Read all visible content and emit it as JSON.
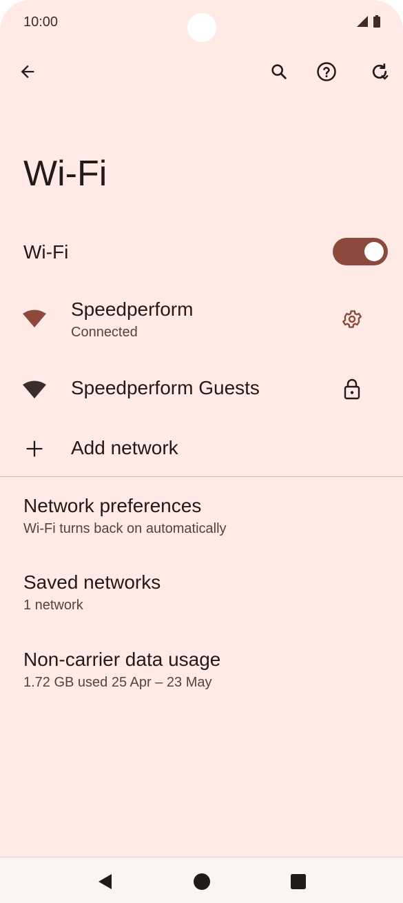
{
  "status_bar": {
    "time": "10:00"
  },
  "toolbar": {
    "back": "back",
    "search": "search",
    "help": "help",
    "refresh": "refresh"
  },
  "page": {
    "title": "Wi-Fi"
  },
  "wifi_toggle": {
    "label": "Wi-Fi",
    "on": true
  },
  "networks": [
    {
      "name": "Speedperform",
      "status": "Connected",
      "trailing_icon": "gear-icon"
    },
    {
      "name": "Speedperform Guests",
      "trailing_icon": "lock-icon"
    }
  ],
  "add_network": {
    "label": "Add network"
  },
  "preferences": [
    {
      "title": "Network preferences",
      "subtitle": "Wi-Fi turns back on automatically"
    },
    {
      "title": "Saved networks",
      "subtitle": "1 network"
    },
    {
      "title": "Non-carrier data usage",
      "subtitle": "1.72 GB used 25 Apr – 23 May"
    }
  ],
  "colors": {
    "background": "#ffeae6",
    "accent": "#8d4a3c",
    "text": "#231917",
    "secondary_text": "#52433f"
  }
}
